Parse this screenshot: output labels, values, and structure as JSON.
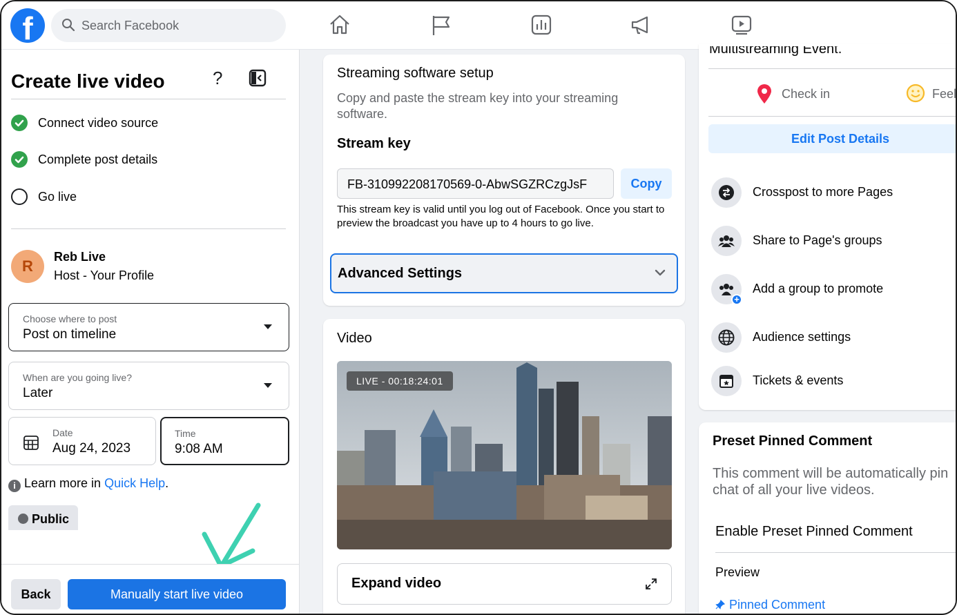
{
  "search": {
    "placeholder": "Search Facebook"
  },
  "left": {
    "title": "Create live video",
    "help_glyph": "?",
    "steps": [
      {
        "label": "Connect video source",
        "done": true
      },
      {
        "label": "Complete post details",
        "done": true
      },
      {
        "label": "Go live",
        "done": false
      }
    ],
    "host": {
      "initial": "R",
      "name": "Reb Live",
      "role": "Host - Your Profile"
    },
    "post_where": {
      "caption": "Choose where to post",
      "value": "Post on timeline"
    },
    "when_live": {
      "caption": "When are you going live?",
      "value": "Later"
    },
    "date": {
      "caption": "Date",
      "value": "Aug 24, 2023"
    },
    "time": {
      "caption": "Time",
      "value": "9:08 AM"
    },
    "learn": {
      "prefix": "Learn more in ",
      "link": "Quick Help",
      "suffix": "."
    },
    "audience": "Public",
    "back_label": "Back",
    "start_label": "Manually start live video"
  },
  "streaming": {
    "title": "Streaming software setup",
    "description": "Copy and paste the stream key into your streaming software.",
    "stream_key_label": "Stream key",
    "stream_key_value": "FB-310992208170569-0-AbwSGZRCzgJsF",
    "copy_label": "Copy",
    "note": "This stream key is valid until you log out of Facebook. Once you start to preview the broadcast you have up to 4 hours to go live.",
    "advanced_label": "Advanced Settings"
  },
  "video": {
    "title": "Video",
    "live_badge": "LIVE - 00:18:24:01",
    "expand_label": "Expand video"
  },
  "right": {
    "cut_text": "Multistreaming Event.",
    "check_in": "Check in",
    "feeling": "Feel",
    "edit_post": "Edit Post Details",
    "options": [
      {
        "label": "Crosspost to more Pages",
        "icon": "crosspost-icon"
      },
      {
        "label": "Share to Page's groups",
        "icon": "groups-icon"
      },
      {
        "label": "Add a group to promote",
        "icon": "add-group-icon"
      },
      {
        "label": "Audience settings",
        "icon": "globe-icon"
      },
      {
        "label": "Tickets & events",
        "icon": "ticket-icon"
      }
    ],
    "pinned": {
      "title": "Preset Pinned Comment",
      "description": "This comment will be automatically pin chat of all your live videos.",
      "enable_label": "Enable Preset Pinned Comment",
      "preview_label": "Preview",
      "pinned_link": "Pinned Comment"
    }
  },
  "colors": {
    "brand": "#1877f2",
    "success": "#31a24c",
    "annotation": "#3ed1b1"
  }
}
